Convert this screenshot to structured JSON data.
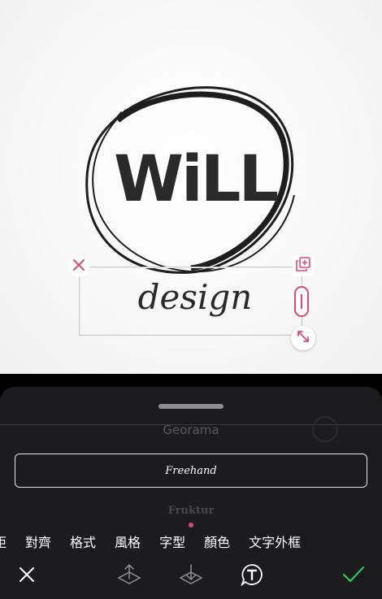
{
  "canvas": {
    "logo_word": "WiLL",
    "design_word": "design"
  },
  "panel": {
    "font_list": {
      "above": "Georama",
      "selected": "Freehand",
      "below": "Fruktur"
    },
    "tabs": [
      "距",
      "對齊",
      "格式",
      "風格",
      "字型",
      "顏色",
      "文字外框"
    ],
    "active_tab": "字型"
  },
  "toolbar": {
    "icons": [
      "close-icon",
      "bring-forward-icon",
      "send-backward-icon",
      "text-style-icon",
      "confirm-check-icon"
    ]
  },
  "colors": {
    "accent_pink": "#d64a7a",
    "confirm_green": "#34c759",
    "panel_bg": "#1c1c1e"
  }
}
